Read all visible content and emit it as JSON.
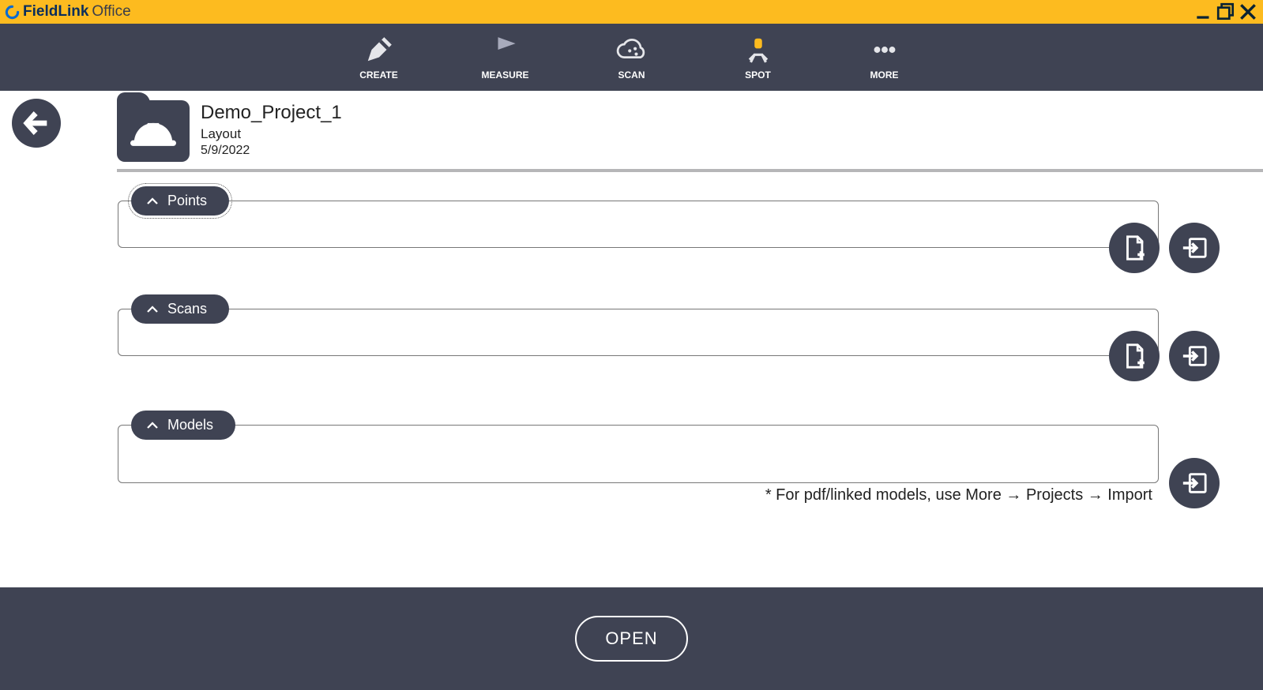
{
  "titlebar": {
    "brand_bold": "FieldLink",
    "brand_light": "Office"
  },
  "toolbar": {
    "create": "CREATE",
    "measure": "MEASURE",
    "scan": "SCAN",
    "spot": "SPOT",
    "more": "MORE"
  },
  "project": {
    "title": "Demo_Project_1",
    "subtitle": "Layout",
    "date": "5/9/2022"
  },
  "sections": {
    "points": "Points",
    "scans": "Scans",
    "models": "Models",
    "models_hint": "* For pdf/linked models, use More → Projects → Import"
  },
  "footer": {
    "open": "OPEN"
  }
}
